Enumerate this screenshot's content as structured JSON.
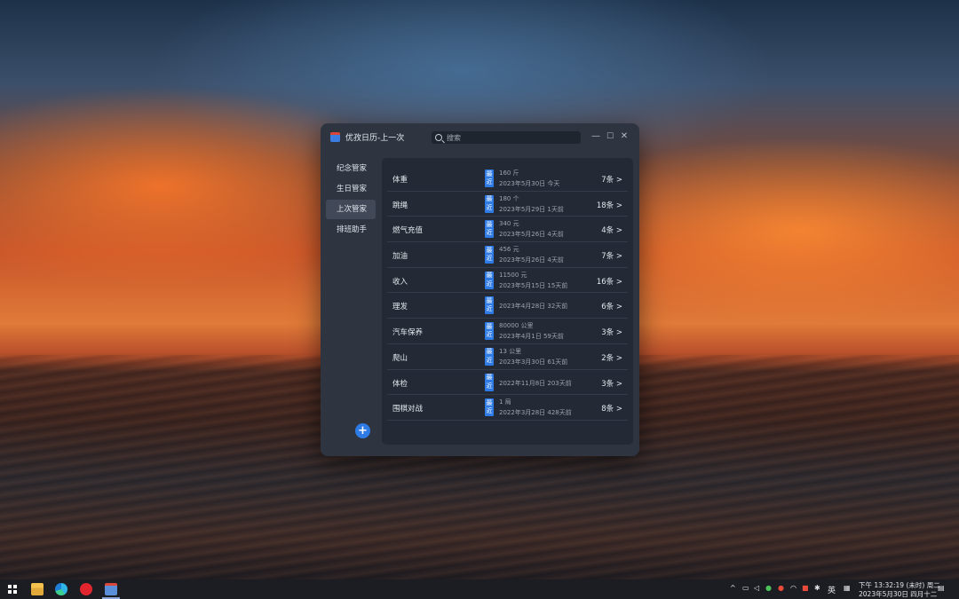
{
  "window": {
    "title": "优孜日历-上一次",
    "search_placeholder": "搜索",
    "minimize": "—",
    "maximize": "☐",
    "close": "✕"
  },
  "sidebar": {
    "items": [
      {
        "label": "纪念管家",
        "active": false
      },
      {
        "label": "生日管家",
        "active": false
      },
      {
        "label": "上次管家",
        "active": true
      },
      {
        "label": "排班助手",
        "active": false
      }
    ],
    "add_label": "+"
  },
  "records": [
    {
      "name": "体重",
      "badge": "最近",
      "value": "160 斤",
      "date": "2023年5月30日 今天",
      "count": "7条 >"
    },
    {
      "name": "跳绳",
      "badge": "最近",
      "value": "180 个",
      "date": "2023年5月29日 1天前",
      "count": "18条 >"
    },
    {
      "name": "燃气充值",
      "badge": "最近",
      "value": "340 元",
      "date": "2023年5月26日 4天前",
      "count": "4条 >"
    },
    {
      "name": "加油",
      "badge": "最近",
      "value": "456 元",
      "date": "2023年5月26日 4天前",
      "count": "7条 >"
    },
    {
      "name": "收入",
      "badge": "最近",
      "value": "11500 元",
      "date": "2023年5月15日 15天前",
      "count": "16条 >"
    },
    {
      "name": "理发",
      "badge": "最近",
      "value": "",
      "date": "2023年4月28日 32天前",
      "count": "6条 >"
    },
    {
      "name": "汽车保养",
      "badge": "最近",
      "value": "80000 公里",
      "date": "2023年4月1日 59天前",
      "count": "3条 >"
    },
    {
      "name": "爬山",
      "badge": "最近",
      "value": "13 公里",
      "date": "2023年3月30日 61天前",
      "count": "2条 >"
    },
    {
      "name": "体检",
      "badge": "最近",
      "value": "",
      "date": "2022年11月8日 203天前",
      "count": "3条 >"
    },
    {
      "name": "围棋对战",
      "badge": "最近",
      "value": "1 局",
      "date": "2022年3月28日 428天前",
      "count": "8条 >"
    }
  ],
  "taskbar": {
    "clock_line1": "下午 13:32:19 (未时) 周二",
    "clock_line2": "2023年5月30日 四月十二",
    "ime": "英",
    "apps": [
      "start-icon",
      "file-explorer-icon",
      "edge-icon",
      "netease-music-icon",
      "calendar-app-icon"
    ]
  },
  "colors": {
    "accent": "#2f7be5",
    "window_bg": "#2e3541",
    "panel_bg": "#232a35"
  }
}
